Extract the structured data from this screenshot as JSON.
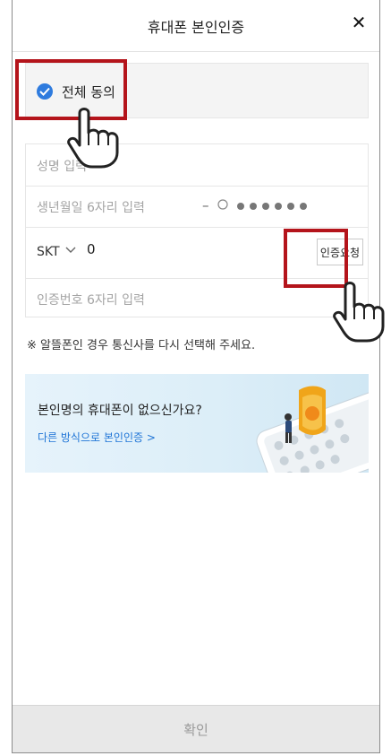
{
  "header": {
    "title": "휴대폰 본인인증",
    "close_symbol": "✕"
  },
  "agree": {
    "label": "전체 동의",
    "checked": true
  },
  "form": {
    "name_placeholder": "성명 입력",
    "birth_placeholder": "생년월일 6자리 입력",
    "id_dash": "–",
    "carrier": "SKT",
    "phone_value": "0",
    "request_button": "인증요청",
    "code_placeholder": "인증번호 6자리 입력"
  },
  "notice": "※ 알뜰폰인 경우 통신사를 다시 선택해 주세요.",
  "banner": {
    "title": "본인명의 휴대폰이 없으신가요?",
    "link": "다른 방식으로 본인인증 >"
  },
  "footer": {
    "confirm_button": "확인"
  },
  "colors": {
    "accent": "#2e7bde",
    "highlight": "#b4141b",
    "link": "#1e74d6"
  }
}
